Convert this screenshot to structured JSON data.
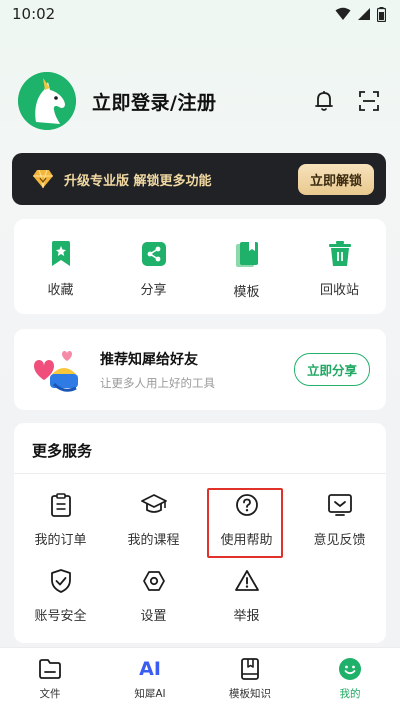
{
  "status_bar": {
    "time": "10:02"
  },
  "profile": {
    "login_label": "立即登录/注册"
  },
  "vip": {
    "text": "升级专业版 解锁更多功能",
    "button": "立即解锁"
  },
  "quick_actions": [
    {
      "label": "收藏",
      "icon": "bookmark-icon"
    },
    {
      "label": "分享",
      "icon": "share-icon"
    },
    {
      "label": "模板",
      "icon": "template-icon"
    },
    {
      "label": "回收站",
      "icon": "trash-icon"
    }
  ],
  "share_card": {
    "title": "推荐知犀给好友",
    "subtitle": "让更多人用上好的工具",
    "button": "立即分享"
  },
  "services": {
    "title": "更多服务",
    "items": [
      {
        "label": "我的订单",
        "icon": "clipboard-icon"
      },
      {
        "label": "我的课程",
        "icon": "graduation-cap-icon"
      },
      {
        "label": "使用帮助",
        "icon": "help-icon"
      },
      {
        "label": "意见反馈",
        "icon": "feedback-icon"
      },
      {
        "label": "账号安全",
        "icon": "shield-check-icon"
      },
      {
        "label": "设置",
        "icon": "gear-icon"
      },
      {
        "label": "举报",
        "icon": "warning-icon"
      }
    ]
  },
  "tabbar": [
    {
      "label": "文件",
      "icon": "folder-icon",
      "active": false
    },
    {
      "label": "知犀AI",
      "icon": "ai-icon",
      "logo_text": "AI",
      "active": false
    },
    {
      "label": "模板知识",
      "icon": "book-icon",
      "active": false
    },
    {
      "label": "我的",
      "icon": "smile-icon",
      "active": true
    }
  ],
  "colors": {
    "brand_green": "#1ea861",
    "highlight_red": "#e0322b",
    "vip_gold": "#f2d9a2",
    "banner_dark": "#202226",
    "ai_blue": "#3a5cf0"
  }
}
